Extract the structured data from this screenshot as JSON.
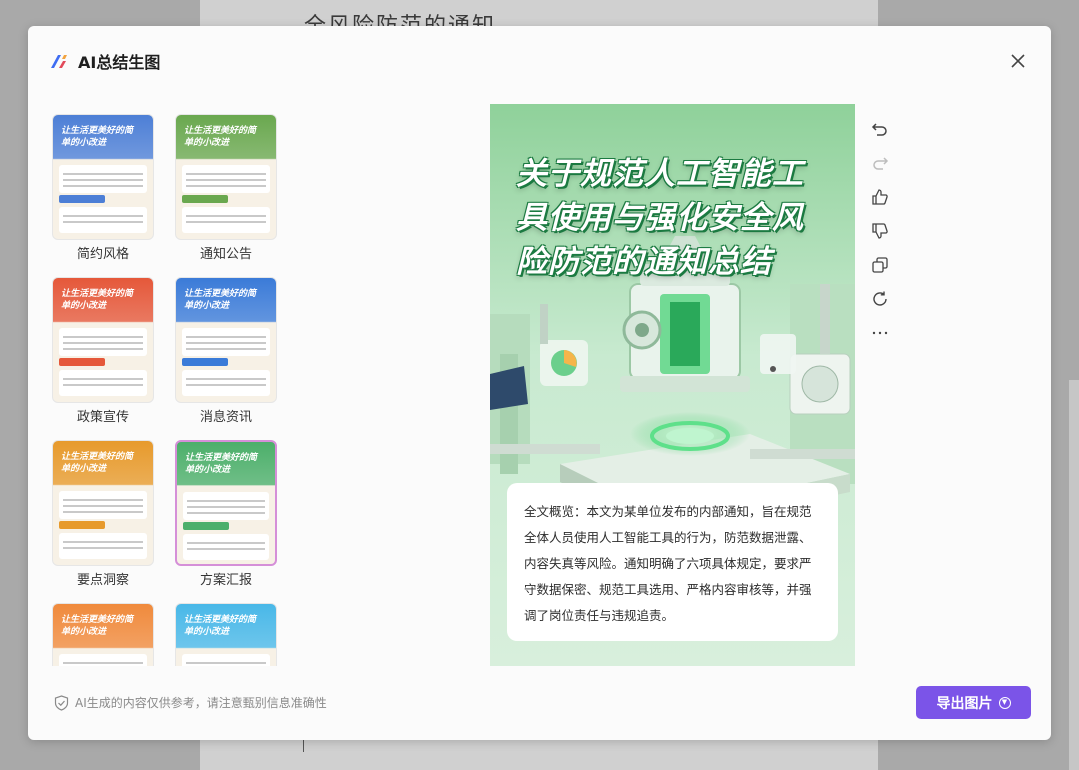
{
  "background": {
    "doc_title": "全风险防范的通知"
  },
  "dialog": {
    "title": "AI总结生图",
    "close_icon": "close-icon"
  },
  "templates": [
    {
      "label": "简约风格",
      "thumb_title": "让生活更美好的简单的小改进",
      "theme": "#4d7fd6"
    },
    {
      "label": "通知公告",
      "thumb_title": "让生活更美好的简单的小改进",
      "theme": "#6aa84f"
    },
    {
      "label": "政策宣传",
      "thumb_title": "让生活更美好的简单的小改进",
      "theme": "#e5583a"
    },
    {
      "label": "消息资讯",
      "thumb_title": "让生活更美好的简单的小改进",
      "theme": "#3b7bd8"
    },
    {
      "label": "要点洞察",
      "thumb_title": "让生活更美好的简单的小改进",
      "theme": "#e79a2c"
    },
    {
      "label": "方案汇报",
      "thumb_title": "让生活更美好的简单的小改进",
      "theme": "#4caf6a",
      "selected": true
    },
    {
      "label": "",
      "thumb_title": "让生活更美好的简单的小改进",
      "theme": "#f08a3c"
    },
    {
      "label": "",
      "thumb_title": "让生活更美好的简单的小改进",
      "theme": "#49b8e8"
    }
  ],
  "preview": {
    "title": "关于规范人工智能工具使用与强化安全风险防范的通知总结",
    "summary": "全文概览：本文为某单位发布的内部通知，旨在规范全体人员使用人工智能工具的行为，防范数据泄露、内容失真等风险。通知明确了六项具体规定，要求严守数据保密、规范工具选用、严格内容审核等，并强调了岗位责任与违规追责。"
  },
  "toolbar": [
    {
      "name": "undo-icon",
      "enabled": true
    },
    {
      "name": "redo-icon",
      "enabled": false
    },
    {
      "name": "thumbs-up-icon",
      "enabled": true
    },
    {
      "name": "thumbs-down-icon",
      "enabled": true
    },
    {
      "name": "copy-icon",
      "enabled": true
    },
    {
      "name": "regenerate-icon",
      "enabled": true
    },
    {
      "name": "more-icon",
      "enabled": true
    }
  ],
  "footer": {
    "disclaimer": "AI生成的内容仅供参考，请注意甄别信息准确性",
    "export_label": "导出图片"
  },
  "colors": {
    "accent": "#7b54e8",
    "poster_green": "#1b7a41",
    "poster_bg": "#cde6cf"
  }
}
